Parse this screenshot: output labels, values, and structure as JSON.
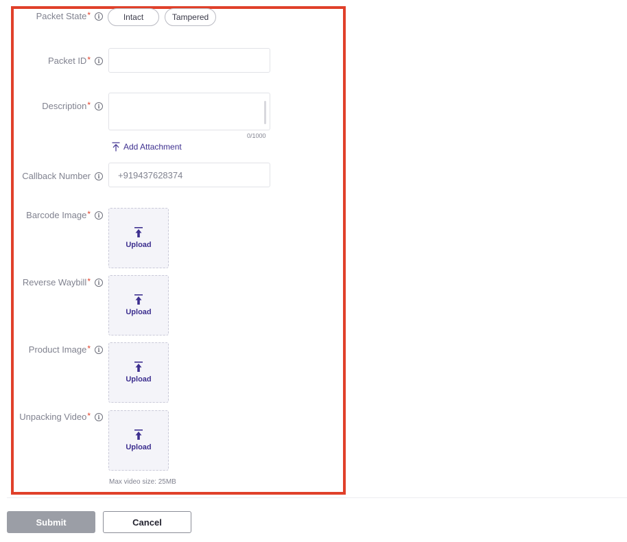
{
  "form": {
    "packet_state": {
      "label": "Packet State",
      "required": "*",
      "options": [
        "Intact",
        "Tampered"
      ]
    },
    "packet_id": {
      "label": "Packet ID",
      "required": "*",
      "value": ""
    },
    "description": {
      "label": "Description",
      "required": "*",
      "value": "",
      "char_count": "0/1000",
      "add_attachment": "Add Attachment"
    },
    "callback_number": {
      "label": "Callback Number",
      "value": "+919437628374"
    },
    "barcode_image": {
      "label": "Barcode Image",
      "required": "*",
      "upload_label": "Upload"
    },
    "reverse_waybill": {
      "label": "Reverse Waybill",
      "required": "*",
      "upload_label": "Upload"
    },
    "product_image": {
      "label": "Product Image",
      "required": "*",
      "upload_label": "Upload"
    },
    "unpacking_video": {
      "label": "Unpacking Video",
      "required": "*",
      "upload_label": "Upload",
      "hint": "Max video size: 25MB"
    }
  },
  "icons": {
    "info": "info-icon",
    "attachment": "upload-arrow-icon",
    "upload": "upload-arrow-icon"
  },
  "colors": {
    "highlight_border": "#e0402a",
    "required_mark": "#e0402a",
    "accent": "#3d2f8f",
    "submit_bg": "#9b9ea6"
  },
  "actions": {
    "submit_label": "Submit",
    "cancel_label": "Cancel"
  }
}
